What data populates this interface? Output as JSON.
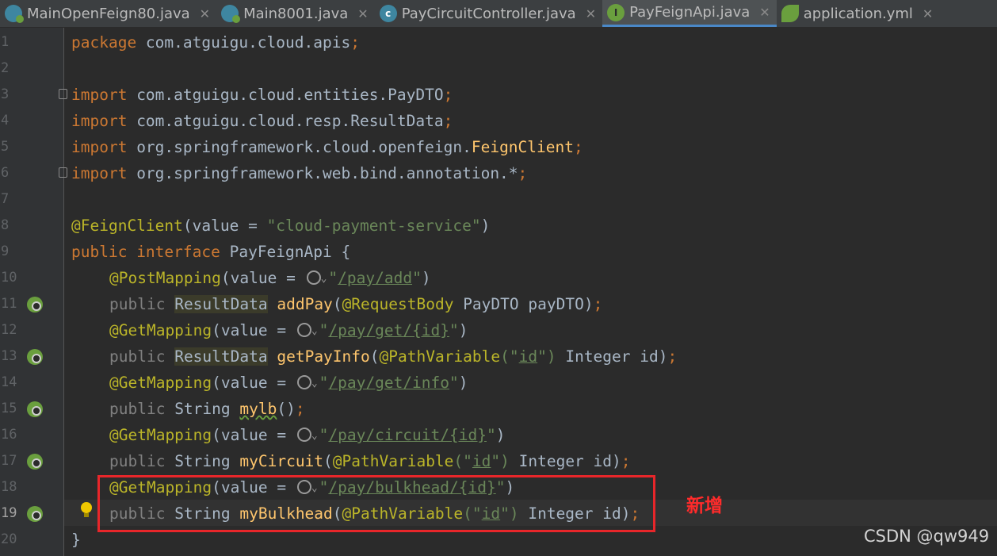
{
  "tabs": [
    {
      "label": "MainOpenFeign80.java",
      "icon": "spring-class-icon",
      "active": false
    },
    {
      "label": "Main8001.java",
      "icon": "spring-class-icon",
      "active": false
    },
    {
      "label": "PayCircuitController.java",
      "icon": "class-icon",
      "active": false
    },
    {
      "label": "PayFeignApi.java",
      "icon": "interface-icon",
      "active": true
    },
    {
      "label": "application.yml",
      "icon": "spring-config-icon",
      "active": false
    }
  ],
  "tab_close_glyph": "✕",
  "tab_icon_letters": {
    "class": "c",
    "interface": "I"
  },
  "line_numbers": [
    "1",
    "2",
    "3",
    "4",
    "5",
    "6",
    "7",
    "8",
    "9",
    "10",
    "11",
    "12",
    "13",
    "14",
    "15",
    "16",
    "17",
    "18",
    "19",
    "20"
  ],
  "code": {
    "l1": {
      "kw": "package",
      "rest": " com.atguigu.cloud.apis",
      "semi": ";"
    },
    "l3": {
      "kw": "import",
      "rest": " com.atguigu.cloud.entities.PayDTO",
      "semi": ";"
    },
    "l4": {
      "kw": "import",
      "rest": " com.atguigu.cloud.resp.ResultData",
      "semi": ";"
    },
    "l5": {
      "kw": "import",
      "rest": " org.springframework.cloud.openfeign.",
      "cls": "FeignClient",
      "semi": ";"
    },
    "l6": {
      "kw": "import",
      "rest": " org.springframework.web.bind.annotation.*",
      "semi": ";"
    },
    "l8": {
      "ann": "@FeignClient",
      "open": "(value = ",
      "str": "\"cloud-payment-service\"",
      "close": ")"
    },
    "l9": {
      "kw1": "public",
      "kw2": " interface",
      "rest": " PayFeignApi {"
    },
    "l10": {
      "ann": "@PostMapping",
      "open": "(value = ",
      "q1": "\"",
      "url": "/pay/add",
      "q2": "\"",
      "close": ")"
    },
    "l11": {
      "kw": "public",
      "type": "ResultData",
      "fn": "addPay",
      "ann": "@RequestBody",
      "rest": " PayDTO payDTO)",
      "semi": ";"
    },
    "l12": {
      "ann": "@GetMapping",
      "open": "(value = ",
      "q1": "\"",
      "url": "/pay/get/{id}",
      "q2": "\"",
      "close": ")"
    },
    "l13": {
      "kw": "public",
      "type": "ResultData",
      "fn": "getPayInfo",
      "ann": "@PathVariable",
      "q1": "(\"",
      "id": "id",
      "q2": "\")",
      "rest": " Integer id)",
      "semi": ";"
    },
    "l14": {
      "ann": "@GetMapping",
      "open": "(value = ",
      "q1": "\"",
      "url": "/pay/get/info",
      "q2": "\"",
      "close": ")"
    },
    "l15": {
      "kw": "public",
      "type": " String ",
      "fn": "mylb",
      "rest": "()",
      "semi": ";"
    },
    "l16": {
      "ann": "@GetMapping",
      "open": "(value = ",
      "q1": "\"",
      "url": "/pay/circuit/{id}",
      "q2": "\"",
      "close": ")"
    },
    "l17": {
      "kw": "public",
      "type": " String ",
      "fn": "myCircuit",
      "ann": "@PathVariable",
      "q1": "(\"",
      "id": "id",
      "q2": "\")",
      "rest": " Integer id)",
      "semi": ";"
    },
    "l18": {
      "ann": "@GetMapping",
      "open": "(value = ",
      "q1": "\"",
      "url": "/pay/bulkhead/{id}",
      "q2": "\"",
      "close": ")"
    },
    "l19": {
      "kw": "public",
      "type": " String ",
      "fn": "myBulkhead",
      "ann": "@PathVariable",
      "q1": "(\"",
      "id": "id",
      "q2": "\")",
      "rest": " Integer id)",
      "semi": ";"
    },
    "l20": {
      "rest": "}"
    }
  },
  "chevron_glyph": "⌄",
  "annotation_note": "新增",
  "watermark": "CSDN @qw949",
  "colors": {
    "keyword": "#cc7832",
    "annotation": "#bbb529",
    "string": "#6a8759",
    "function": "#ffc66d",
    "highlight_box": "#e8262a"
  }
}
